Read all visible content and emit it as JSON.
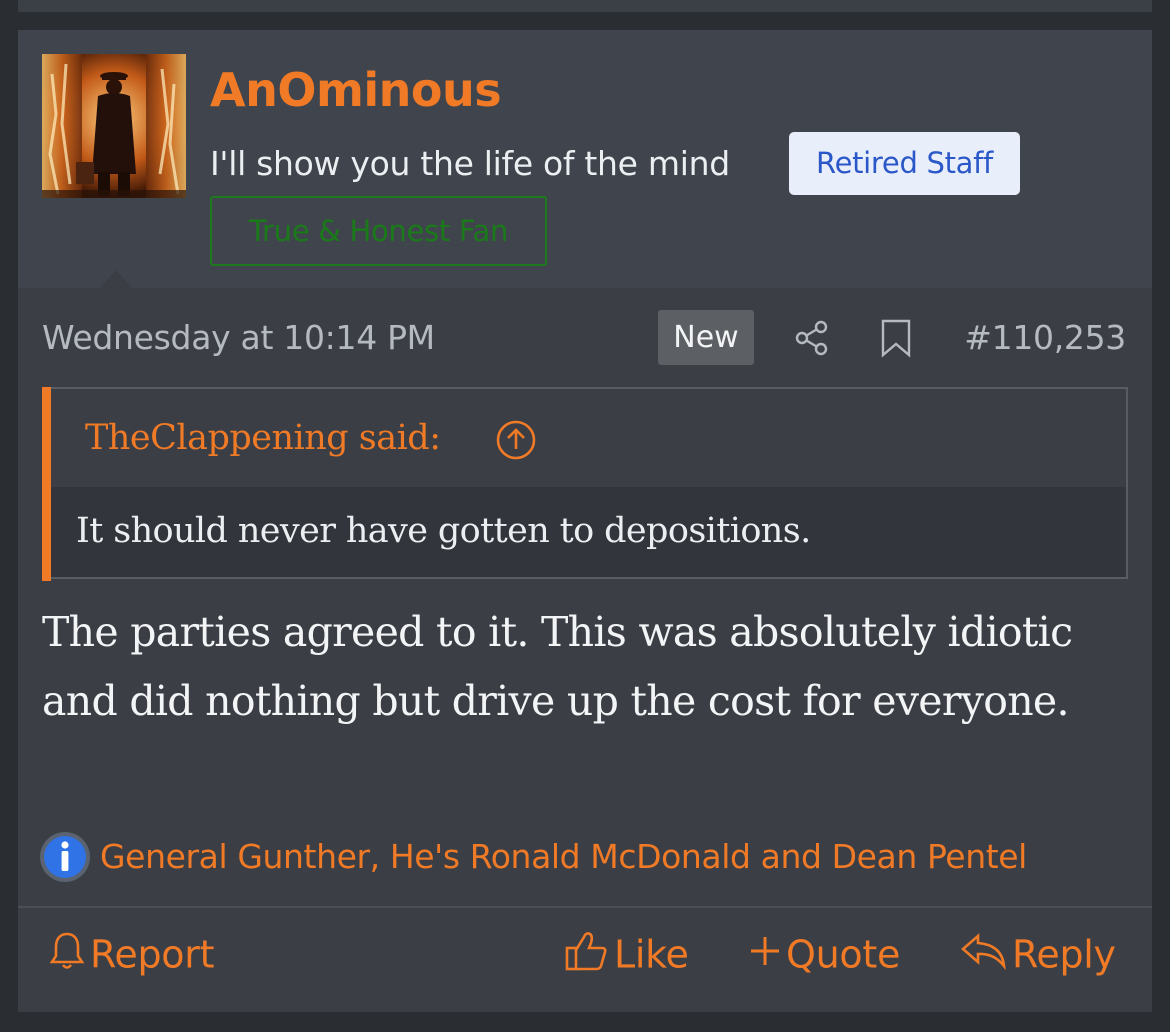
{
  "post": {
    "username": "AnOminous",
    "user_title": "I'll show you the life of the mind",
    "badges": {
      "staff": "Retired Staff",
      "fan": "True & Honest Fan"
    },
    "date": "Wednesday at 10:14 PM",
    "new_label": "New",
    "post_number": "#110,253",
    "quote": {
      "author": "TheClappening said:",
      "text": "It should never have gotten to depositions."
    },
    "body": "The parties agreed to it. This was absolutely idiotic and did nothing but drive up the cost for everyone.",
    "reactions": "General Gunther, He's Ronald McDonald and Dean Pentel"
  },
  "actions": {
    "report": "Report",
    "like": "Like",
    "quote": "Quote",
    "reply": "Reply"
  },
  "colors": {
    "accent": "#f07a26",
    "staff_badge_bg": "#e9eefb",
    "staff_badge_text": "#2b58c8",
    "fan_badge": "#1a7a1a",
    "post_bg": "#3b3e45",
    "page_bg": "#2a2d32"
  },
  "icons": {
    "share": "share-icon",
    "bookmark": "bookmark-icon",
    "quote_jump": "arrow-up-circle-icon",
    "reactions": "info-icon",
    "report": "bell-icon",
    "like": "thumbs-up-icon",
    "quote": "plus-icon",
    "reply": "reply-icon"
  }
}
